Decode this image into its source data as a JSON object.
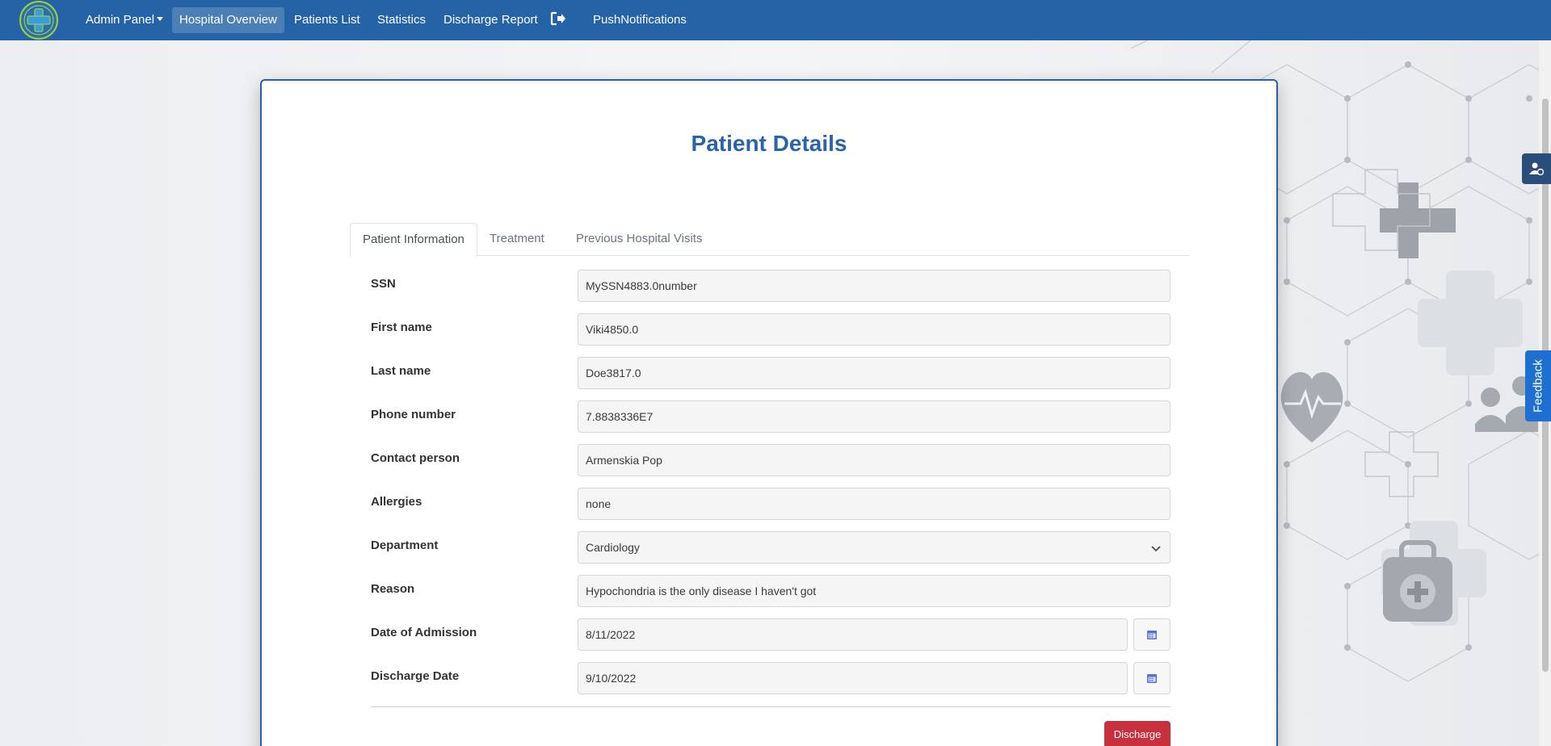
{
  "nav": {
    "items": [
      {
        "label": "Admin Panel"
      },
      {
        "label": "Hospital Overview"
      },
      {
        "label": "Patients List"
      },
      {
        "label": "Statistics"
      },
      {
        "label": "Discharge Report"
      },
      {
        "label": "PushNotifications"
      }
    ]
  },
  "page": {
    "title": "Patient Details"
  },
  "tabs": [
    {
      "label": "Patient Information"
    },
    {
      "label": "Treatment"
    },
    {
      "label": "Previous Hospital Visits"
    }
  ],
  "form": {
    "ssn": {
      "label": "SSN",
      "value": "MySSN4883.0number"
    },
    "first_name": {
      "label": "First name",
      "value": "Viki4850.0"
    },
    "last_name": {
      "label": "Last name",
      "value": "Doe3817.0"
    },
    "phone": {
      "label": "Phone number",
      "value": "7.8838336E7"
    },
    "contact": {
      "label": "Contact person",
      "value": "Armenskia Pop"
    },
    "allergies": {
      "label": "Allergies",
      "value": "none"
    },
    "department": {
      "label": "Department",
      "value": "Cardiology"
    },
    "reason": {
      "label": "Reason",
      "value": "Hypochondria is the only disease I haven't got"
    },
    "admission": {
      "label": "Date of Admission",
      "value": "8/11/2022"
    },
    "discharge": {
      "label": "Discharge Date",
      "value": "9/10/2022"
    }
  },
  "actions": {
    "discharge_label": "Discharge"
  },
  "widgets": {
    "feedback_label": "Feedback"
  },
  "colors": {
    "navbar": "#2563a6",
    "title": "#2a63a8",
    "discharge_button": "#c9303d",
    "feedback": "#1e6fd0"
  }
}
